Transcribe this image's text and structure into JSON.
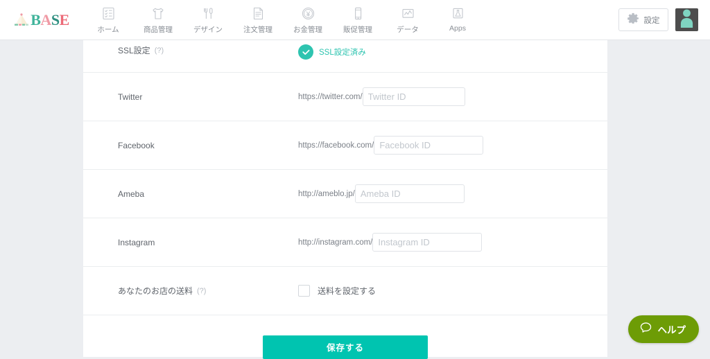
{
  "header": {
    "logo": {
      "name": "BASE",
      "letters": [
        {
          "char": "B",
          "color": "#3fb39a"
        },
        {
          "char": "A",
          "color": "#f09aa5"
        },
        {
          "char": "S",
          "color": "#2f8f80"
        },
        {
          "char": "E",
          "color": "#ec6b78"
        }
      ],
      "mark_colors": {
        "tent": "#f7e9c9",
        "flag": "#f09aa5",
        "ground": "#7cc6a8"
      }
    },
    "nav": [
      {
        "label": "ホーム",
        "icon": "checklist-icon"
      },
      {
        "label": "商品管理",
        "icon": "tshirt-icon"
      },
      {
        "label": "デザイン",
        "icon": "tools-icon"
      },
      {
        "label": "注文管理",
        "icon": "document-icon"
      },
      {
        "label": "お金管理",
        "icon": "coin-yen-icon"
      },
      {
        "label": "販促管理",
        "icon": "smartphone-icon"
      },
      {
        "label": "データ",
        "icon": "chart-icon"
      },
      {
        "label": "Apps",
        "icon": "flask-icon"
      }
    ],
    "settings_label": "設定",
    "settings_icon": "gear-icon",
    "avatar_icon": "user-avatar-icon"
  },
  "settings_rows": {
    "ssl": {
      "label": "SSL設定",
      "help": "(?)",
      "status_text": "SSL設定済み",
      "status_icon": "check-circle-icon",
      "status_color": "#2ec4b0"
    },
    "social": [
      {
        "label": "Twitter",
        "prefix": "https://twitter.com/",
        "placeholder": "Twitter ID",
        "value": "",
        "input_width": 148
      },
      {
        "label": "Facebook",
        "prefix": "https://facebook.com/",
        "placeholder": "Facebook ID",
        "value": "",
        "input_width": 158
      },
      {
        "label": "Ameba",
        "prefix": "http://ameblo.jp/",
        "placeholder": "Ameba ID",
        "value": "",
        "input_width": 158
      },
      {
        "label": "Instagram",
        "prefix": "http://instagram.com/",
        "placeholder": "Instagram ID",
        "value": "",
        "input_width": 158
      }
    ],
    "shipping": {
      "label": "あなたのお店の送料",
      "help": "(?)",
      "checkbox_label": "送料を設定する",
      "checked": false
    },
    "save_label": "保存する"
  },
  "help_fab": {
    "label": "ヘルプ",
    "icon": "chat-bubble-icon",
    "color": "#6d9c06"
  }
}
